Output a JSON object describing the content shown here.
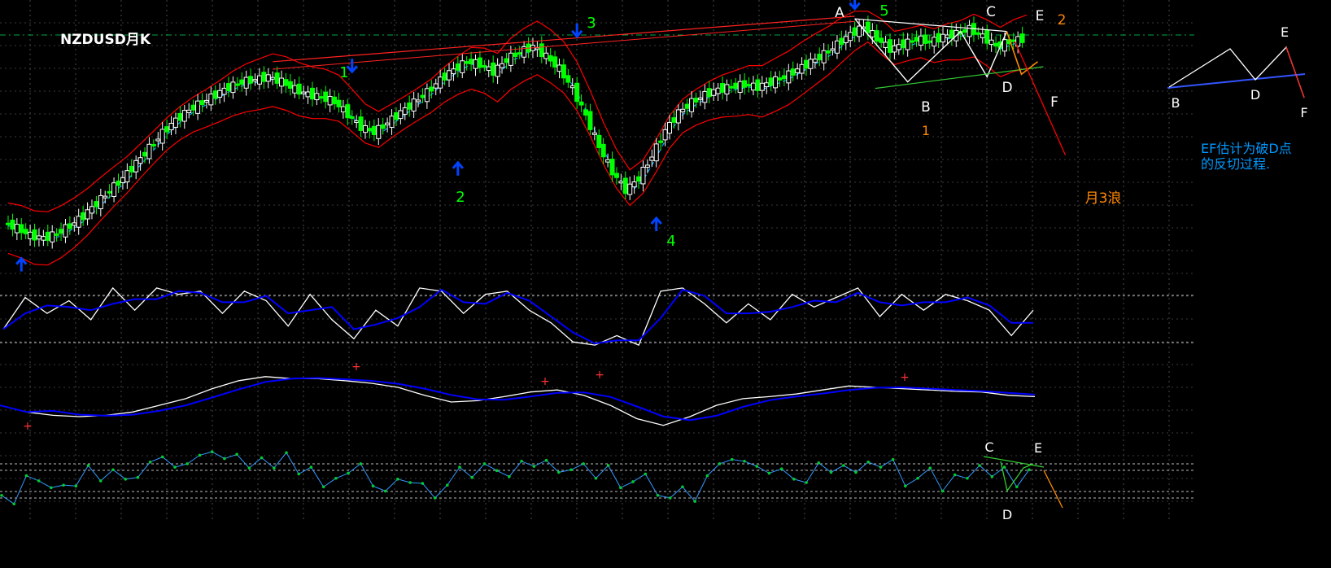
{
  "symbol_label": "NZDUSD月K",
  "chart_data": {
    "type": "candlestick",
    "title": "NZDUSD月K",
    "colors": {
      "background": "#000000",
      "up_candle": "#ffffff",
      "down_candle": "#00ff00",
      "bands": "#ff0000",
      "mid_line": "#00aaff",
      "oscillator_fast": "#ffffff",
      "oscillator_slow": "#0000ff",
      "dot_line": "#00cc33",
      "wave_labels": "#00ff00",
      "arrows": "#0044ff",
      "abcde_lines": "#ffffff",
      "projection": "#ff8800",
      "projection_main": "#ff0000",
      "annotation_note": "#0099ff"
    },
    "price": [
      0.18,
      0.16,
      0.13,
      0.12,
      0.14,
      0.17,
      0.21,
      0.26,
      0.31,
      0.36,
      0.42,
      0.48,
      0.54,
      0.59,
      0.63,
      0.66,
      0.69,
      0.72,
      0.74,
      0.75,
      0.76,
      0.74,
      0.71,
      0.69,
      0.68,
      0.66,
      0.61,
      0.56,
      0.54,
      0.58,
      0.62,
      0.66,
      0.7,
      0.75,
      0.79,
      0.82,
      0.81,
      0.78,
      0.83,
      0.86,
      0.88,
      0.84,
      0.79,
      0.71,
      0.6,
      0.48,
      0.38,
      0.31,
      0.36,
      0.45,
      0.55,
      0.62,
      0.66,
      0.69,
      0.71,
      0.72,
      0.73,
      0.72,
      0.74,
      0.76,
      0.79,
      0.82,
      0.85,
      0.89,
      0.93,
      0.96,
      0.91,
      0.87,
      0.89,
      0.91,
      0.9,
      0.92,
      0.93,
      0.95,
      0.92,
      0.88,
      0.9,
      0.91
    ],
    "oscillator_1": [
      0.3,
      0.8,
      0.55,
      0.75,
      0.45,
      0.95,
      0.6,
      0.95,
      0.85,
      0.9,
      0.55,
      0.9,
      0.75,
      0.35,
      0.85,
      0.45,
      0.15,
      0.6,
      0.35,
      0.95,
      0.9,
      0.55,
      0.85,
      0.9,
      0.6,
      0.4,
      0.1,
      0.05,
      0.2,
      0.05,
      0.9,
      0.95,
      0.7,
      0.4,
      0.7,
      0.45,
      0.85,
      0.65,
      0.8,
      0.95,
      0.5,
      0.85,
      0.6,
      0.85,
      0.75,
      0.6,
      0.2,
      0.6
    ],
    "oscillator_2": [
      0.45,
      0.35,
      0.3,
      0.28,
      0.3,
      0.35,
      0.45,
      0.55,
      0.7,
      0.82,
      0.88,
      0.85,
      0.85,
      0.82,
      0.78,
      0.72,
      0.6,
      0.5,
      0.52,
      0.58,
      0.65,
      0.68,
      0.6,
      0.45,
      0.25,
      0.15,
      0.28,
      0.45,
      0.55,
      0.58,
      0.62,
      0.68,
      0.74,
      0.72,
      0.7,
      0.68,
      0.66,
      0.65,
      0.6,
      0.58
    ],
    "dot_series": [
      0.25,
      0.15,
      0.48,
      0.42,
      0.34,
      0.37,
      0.36,
      0.6,
      0.42,
      0.55,
      0.44,
      0.46,
      0.64,
      0.7,
      0.58,
      0.62,
      0.72,
      0.76,
      0.68,
      0.73,
      0.57,
      0.69,
      0.57,
      0.75,
      0.5,
      0.58,
      0.35,
      0.45,
      0.51,
      0.62,
      0.36,
      0.3,
      0.44,
      0.4,
      0.39,
      0.22,
      0.37,
      0.58,
      0.46,
      0.62,
      0.54,
      0.47,
      0.65,
      0.59,
      0.66,
      0.52,
      0.55,
      0.62,
      0.45,
      0.6,
      0.34,
      0.41,
      0.5,
      0.25,
      0.22,
      0.35,
      0.18,
      0.48,
      0.62,
      0.67,
      0.65,
      0.59,
      0.51,
      0.56,
      0.44,
      0.4,
      0.63,
      0.52,
      0.6,
      0.52,
      0.64,
      0.58,
      0.67,
      0.36,
      0.45,
      0.57,
      0.3,
      0.49,
      0.45,
      0.6,
      0.47,
      0.58,
      0.35,
      0.55
    ],
    "wave_labels": [
      {
        "label": "1",
        "bar": 26
      },
      {
        "label": "2",
        "bar": 34
      },
      {
        "label": "3",
        "bar": 43
      },
      {
        "label": "4",
        "bar": 49
      },
      {
        "label": "5",
        "bar": 64
      }
    ],
    "pattern_labels": [
      {
        "label": "A"
      },
      {
        "label": "B"
      },
      {
        "label": "C"
      },
      {
        "label": "D"
      },
      {
        "label": "E"
      },
      {
        "label": "F"
      }
    ],
    "projection_labels": [
      {
        "label": "2"
      },
      {
        "label": "1"
      },
      {
        "label": "月3浪"
      }
    ],
    "legend_diagram": {
      "labels": [
        "B",
        "D",
        "E",
        "F"
      ]
    },
    "note_lines": [
      "EF估计为破D点",
      "的反切过程."
    ],
    "osc3_labels": [
      "C",
      "E",
      "D"
    ]
  }
}
